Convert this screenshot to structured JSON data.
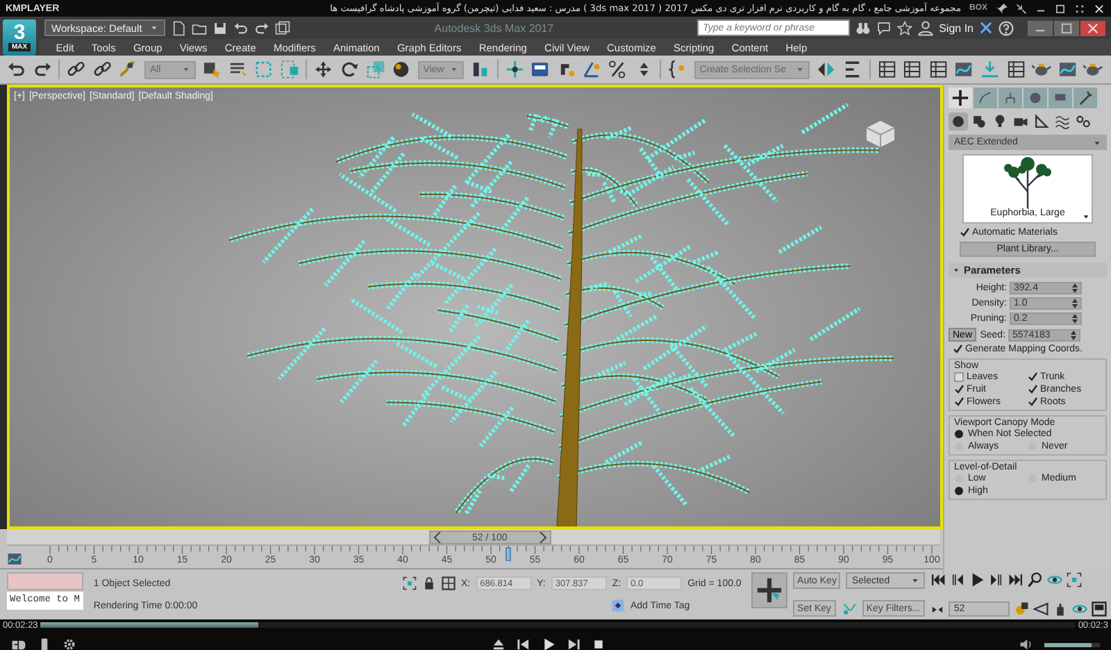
{
  "player": {
    "brand": "KMPLAYER",
    "title": "مجموعه آموزشی جامع ، گام به گام و کاربردی نرم افزار تری دی مکس 2017  ( 3ds max 2017 )  مدرس : سعید فدایی (تیچرمن) گروه آموزشی پادشاه گرافیست ها",
    "box": "BOX",
    "elapsed": "00:02:23",
    "total": "00:02:3",
    "progress": {
      "level": 0.21
    },
    "volume": {
      "level": 0.85
    }
  },
  "app_button": {
    "label": "3",
    "sub": "MAX"
  },
  "title_bar": {
    "workspace": "Workspace: Default",
    "doc_title": "Autodesk 3ds Max 2017",
    "search_placeholder": "Type a keyword or phrase",
    "sign_in": "Sign In"
  },
  "menu": [
    "Edit",
    "Tools",
    "Group",
    "Views",
    "Create",
    "Modifiers",
    "Animation",
    "Graph Editors",
    "Rendering",
    "Civil View",
    "Customize",
    "Scripting",
    "Content",
    "Help"
  ],
  "toolbar": {
    "selection_filter": "All",
    "reference_coord": "View",
    "named_selection": "Create Selection Se"
  },
  "viewport": {
    "labels": [
      "[+]",
      "[Perspective]",
      "[Standard]",
      "[Default Shading]"
    ]
  },
  "command_panel": {
    "tabs": [
      {
        "kind": "create",
        "selected": true
      },
      {
        "kind": "modify",
        "selected": false
      },
      {
        "kind": "hierarchy",
        "selected": false
      },
      {
        "kind": "motion",
        "selected": false
      },
      {
        "kind": "display",
        "selected": false
      },
      {
        "kind": "utilities",
        "selected": false
      }
    ],
    "categories": [
      {
        "kind": "geometry",
        "selected": true
      },
      {
        "kind": "shapes",
        "selected": false
      },
      {
        "kind": "lights",
        "selected": false
      },
      {
        "kind": "cameras",
        "selected": false
      },
      {
        "kind": "helpers",
        "selected": false
      },
      {
        "kind": "spacewarps",
        "selected": false
      },
      {
        "kind": "systems",
        "selected": false
      }
    ],
    "object_type": "AEC Extended",
    "plant_name": "Euphorbia, Large",
    "automatic_materials": {
      "label": "Automatic Materials",
      "checked": true
    },
    "plant_library": "Plant Library...",
    "parameters": {
      "title": "Parameters",
      "fields": [
        {
          "label": "Height:",
          "value": "392.4"
        },
        {
          "label": "Density:",
          "value": "1.0"
        },
        {
          "label": "Pruning:",
          "value": "0.2"
        }
      ],
      "new_button": "New",
      "seed": {
        "label": "Seed:",
        "value": "5574183"
      },
      "mapping": {
        "label": "Generate Mapping Coords.",
        "checked": true
      },
      "show": {
        "title": "Show",
        "items": [
          {
            "label": "Leaves",
            "checked": false
          },
          {
            "label": "Trunk",
            "checked": true
          },
          {
            "label": "Fruit",
            "checked": true
          },
          {
            "label": "Branches",
            "checked": true
          },
          {
            "label": "Flowers",
            "checked": true
          },
          {
            "label": "Roots",
            "checked": true
          }
        ]
      },
      "canopy": {
        "title": "Viewport Canopy Mode",
        "options": [
          {
            "label": "When Not Selected",
            "selected": true
          },
          {
            "label": "Always",
            "selected": false
          },
          {
            "label": "Never",
            "selected": false
          }
        ]
      },
      "lod": {
        "title": "Level-of-Detail",
        "options": [
          {
            "label": "Low",
            "selected": false
          },
          {
            "label": "Medium",
            "selected": false
          },
          {
            "label": "High",
            "selected": true
          }
        ]
      }
    }
  },
  "time_slider": {
    "label": "52 / 100",
    "level": 0.52,
    "ticks": [
      "0",
      "5",
      "10",
      "15",
      "20",
      "25",
      "30",
      "35",
      "40",
      "45",
      "50",
      "55",
      "60",
      "65",
      "70",
      "75",
      "80",
      "85",
      "90",
      "95",
      "100"
    ]
  },
  "status": {
    "listener": "Welcome to M",
    "selection": "1 Object Selected",
    "render_time": "Rendering Time  0:00:00",
    "coords": [
      {
        "label": "X:",
        "value": "686.814"
      },
      {
        "label": "Y:",
        "value": "307.837"
      },
      {
        "label": "Z:",
        "value": "0.0"
      }
    ],
    "grid": "Grid = 100.0",
    "time_tag": "Add Time Tag",
    "auto_key": "Auto Key",
    "key_mode": "Selected",
    "set_key": "Set Key",
    "key_filters": "Key Filters...",
    "frame": "52"
  }
}
